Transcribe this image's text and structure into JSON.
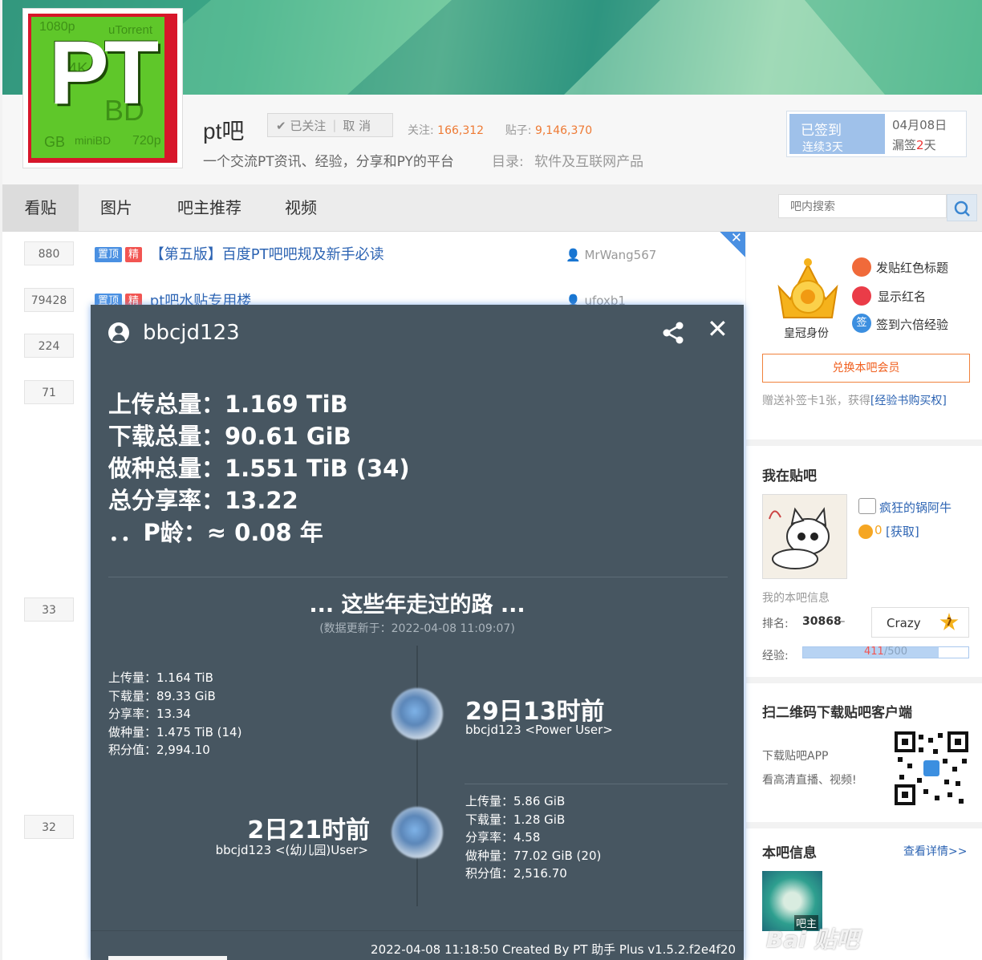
{
  "forum": {
    "name": "pt吧",
    "follow_label": "✔ 已关注",
    "cancel_label": "取 消",
    "followers_label": "关注:",
    "followers": "166,312",
    "posts_label": "贴子:",
    "posts": "9,146,370",
    "slogan": "一个交流PT资讯、经验，分享和PY的平台",
    "dir_label": "目录:",
    "dir_value": "软件及互联网产品",
    "logo_text": "PT"
  },
  "signin": {
    "status": "已签到",
    "streak": "连续3天",
    "date": "04月08日",
    "missed_prefix": "漏签",
    "missed_count": "2",
    "missed_suffix": "天"
  },
  "nav": {
    "tabs": [
      "看贴",
      "图片",
      "吧主推荐",
      "视频"
    ],
    "search_placeholder": "吧内搜索"
  },
  "threads": [
    {
      "replies": "880",
      "tag_top": "置顶",
      "tag_jing": "精",
      "title": "【第五版】百度PT吧吧规及新手必读",
      "author": "MrWang567"
    },
    {
      "replies": "79428",
      "tag_top": "置顶",
      "tag_jing": "精",
      "title": "pt吧水贴专用楼",
      "author": "ufoxb1"
    },
    {
      "replies": "224"
    },
    {
      "replies": "71"
    },
    {
      "replies": "33"
    },
    {
      "replies": "32"
    }
  ],
  "sidebar": {
    "crown_label": "皇冠身份",
    "perks": [
      "发贴红色标题",
      "显示红名",
      "签到六倍经验"
    ],
    "exchange_button": "兑换本吧会员",
    "exchange_note_prefix": "赠送补签卡1张，获得",
    "exchange_note_link": "[经验书购买权]",
    "my_forum_title": "我在贴吧",
    "my_name": "疯狂的锅阿牛",
    "my_coins": "0",
    "get_link": "[获取]",
    "my_info_label": "我的本吧信息",
    "rank_label": "排名:",
    "rank_value": "30868",
    "level_name": "Crazy",
    "level_num": "7",
    "exp_label": "经验:",
    "exp_current": "411",
    "exp_total": "/500",
    "exp_fraction": 0.822,
    "qr_title": "扫二维码下载贴吧客户端",
    "qr_line1": "下载贴吧APP",
    "qr_line2": "看高清直播、视频!",
    "info_title": "本吧信息",
    "info_link": "查看详情>>",
    "owner_label": "吧主"
  },
  "overlay": {
    "username": "bbcjd123",
    "stats": [
      "上传总量：1.169 TiB",
      "下载总量：90.61 GiB",
      "做种总量：1.551 TiB (34)",
      "总分享率：13.22",
      "．．P龄：≈ 0.08 年"
    ],
    "road_title": "... 这些年走过的路 ...",
    "updated": "(数据更新于：2022-04-08 11:09:07)",
    "entry1": {
      "ago": "29日13时前",
      "user": "bbcjd123 <Power User>",
      "stats": [
        "上传量：1.164 TiB",
        "下载量：89.33 GiB",
        "分享率：13.34",
        "做种量：1.475 TiB (14)",
        "积分值：2,994.10"
      ]
    },
    "entry2": {
      "ago": "2日21时前",
      "user": "bbcjd123 <(幼儿园)User>",
      "stats": [
        "上传量：5.86 GiB",
        "下载量：1.28 GiB",
        "分享率：4.58",
        "做种量：77.02 GiB (20)",
        "积分值：2,516.70"
      ]
    },
    "footer": "2022-04-08 11:18:50 Created By PT 助手 Plus v1.5.2.f2e4f20"
  },
  "watermark": "Bai 贴吧"
}
